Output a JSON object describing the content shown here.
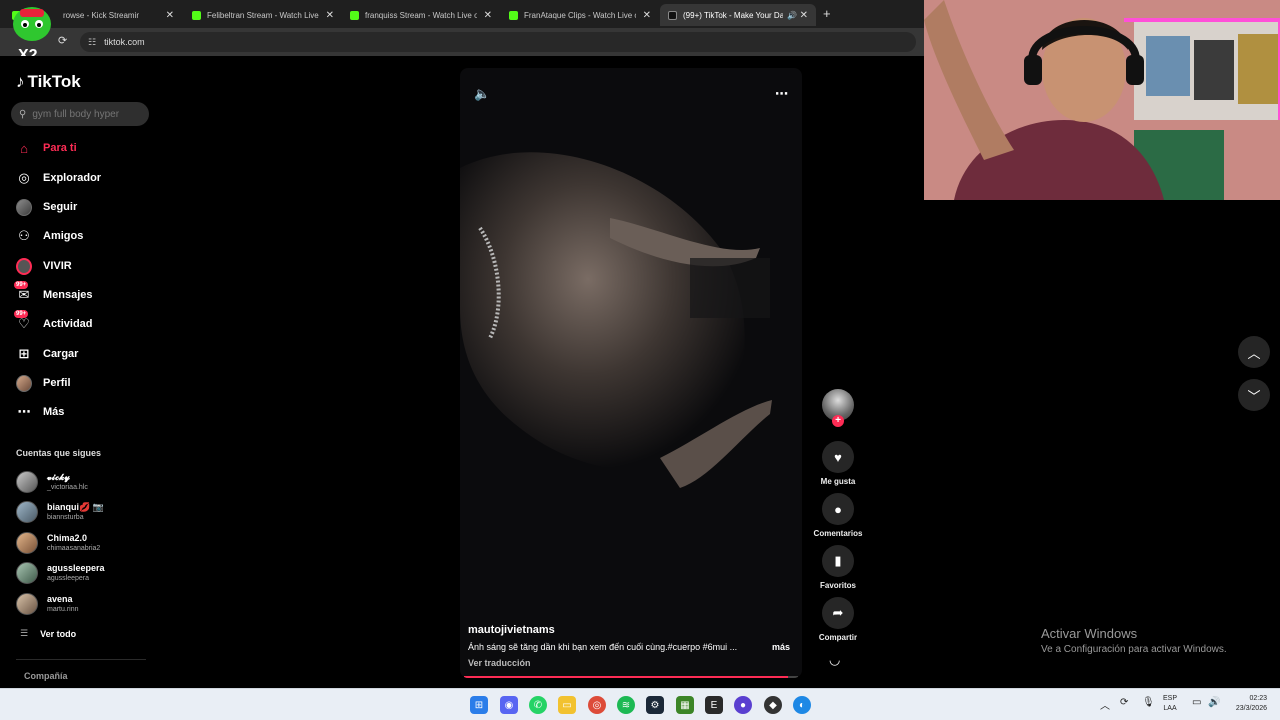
{
  "browser": {
    "tabs": [
      {
        "label": "rowse - Kick Streaming",
        "favicon": "kick-icon",
        "active": false
      },
      {
        "label": "Felibeltran Stream - Watch Live",
        "favicon": "kick-icon",
        "active": false
      },
      {
        "label": "franquiss Stream - Watch Live o",
        "favicon": "kick-icon",
        "active": false
      },
      {
        "label": "FranAtaque Clips - Watch Live o",
        "favicon": "kick-icon",
        "active": false
      },
      {
        "label": "(99+) TikTok - Make Your Da",
        "favicon": "tiktok-icon",
        "active": true
      }
    ],
    "url": "tiktok.com"
  },
  "overlay": {
    "badge": "X2"
  },
  "tiktok": {
    "brand": "TikTok",
    "search_placeholder": "gym full body hyper",
    "nav": [
      {
        "label": "Para ti",
        "icon": "home-icon",
        "active": true
      },
      {
        "label": "Explorador",
        "icon": "compass-icon"
      },
      {
        "label": "Seguir",
        "icon": "avatar"
      },
      {
        "label": "Amigos",
        "icon": "friends-icon"
      },
      {
        "label": "VIVIR",
        "icon": "live-icon"
      },
      {
        "label": "Mensajes",
        "icon": "messages-icon",
        "badge": "99+"
      },
      {
        "label": "Actividad",
        "icon": "activity-icon",
        "badge": "99+"
      },
      {
        "label": "Cargar",
        "icon": "upload-icon"
      },
      {
        "label": "Perfil",
        "icon": "profile-avatar"
      },
      {
        "label": "Más",
        "icon": "more-icon"
      }
    ],
    "following_title": "Cuentas que sigues",
    "following": [
      {
        "name": "𝓿𝓲𝓬𝓴𝔂",
        "user": "_victoriaa.hlc"
      },
      {
        "name": "bianqui💋 📷",
        "user": "biannsturba"
      },
      {
        "name": "Chima2.0",
        "user": "chimaasanabria2"
      },
      {
        "name": "agussleepera",
        "user": "agussleepera"
      },
      {
        "name": "avena",
        "user": "martu.rinn"
      }
    ],
    "see_all": "Ver todo",
    "company": "Compañía"
  },
  "video": {
    "author": "mautojivietnams",
    "description": "Ánh sáng sẽ tăng dần khi bạn xem đến cuối cùng.#cuerpo #6mui ...",
    "more": "más",
    "translate": "Ver traducción",
    "progress": 0.97,
    "actions": {
      "like": "Me gusta",
      "comments": "Comentarios",
      "favorites": "Favoritos",
      "share": "Compartir"
    }
  },
  "windows": {
    "activate_title": "Activar Windows",
    "activate_sub": "Ve a Configuración para activar Windows.",
    "lang_top": "ESP",
    "lang_bottom": "LAA",
    "time": "02:23",
    "date": "23/3/2026"
  }
}
